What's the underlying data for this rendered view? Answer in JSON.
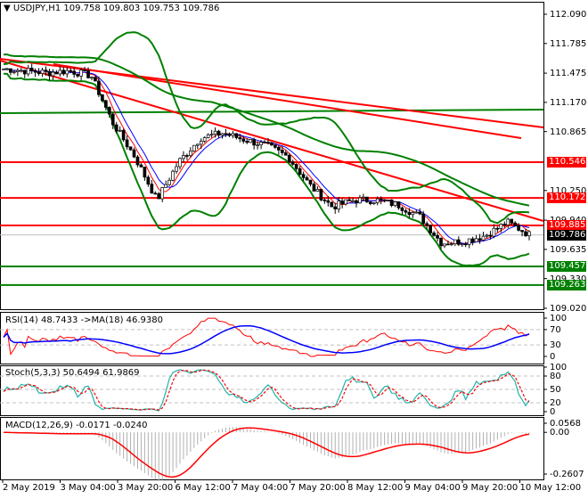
{
  "header": {
    "symbol": "USDJPY,H1",
    "open": "109.758",
    "high": "109.803",
    "low": "109.753",
    "close": "109.786"
  },
  "colors": {
    "bull": "#000000",
    "bear": "#000000",
    "support": "#008000",
    "resistance": "#ff0000",
    "bands": "#008000",
    "current": "#000000"
  },
  "chart_data": [
    {
      "type": "candlestick",
      "title": "USDJPY,H1",
      "ylim": [
        109.02,
        112.09
      ],
      "y_ticks": [
        "112.090",
        "111.785",
        "111.475",
        "111.170",
        "110.865",
        "110.546",
        "110.250",
        "110.172",
        "109.940",
        "109.885",
        "109.786",
        "109.635",
        "109.457",
        "109.330",
        "109.263",
        "109.020"
      ],
      "x_ticks": [
        "2 May 2019",
        "3 May 04:00",
        "3 May 20:00",
        "6 May 12:00",
        "7 May 04:00",
        "7 May 20:00",
        "8 May 12:00",
        "9 May 04:00",
        "9 May 20:00",
        "10 May 12:00"
      ],
      "approx_close_path": [
        111.52,
        111.5,
        111.48,
        111.5,
        111.45,
        110.95,
        110.6,
        110.15,
        110.55,
        110.8,
        110.85,
        110.78,
        110.72,
        110.6,
        110.3,
        110.08,
        110.15,
        110.15,
        110.1,
        109.98,
        109.7,
        109.72,
        109.78,
        109.92,
        109.79
      ],
      "levels": {
        "resistance": [
          "110.546",
          "110.172",
          "109.885"
        ],
        "support": [
          "109.457",
          "109.263"
        ],
        "current": "109.786"
      }
    },
    {
      "type": "line",
      "title": "RSI(14) 48.7433  ->MA(18) 46.9380",
      "ylim": [
        0,
        100
      ],
      "y_ticks": [
        "100",
        "70",
        "30",
        "0"
      ]
    },
    {
      "type": "line",
      "title": "Stoch(5,3,3) 50.6494 61.9869",
      "ylim": [
        0,
        100
      ],
      "y_ticks": [
        "100",
        "80",
        "50",
        "20",
        "0"
      ]
    },
    {
      "type": "bar",
      "title": "MACD(12,26,9) -0.0171 -0.0240",
      "ylim": [
        -0.2607,
        0.0568
      ],
      "y_ticks": [
        "0.0568",
        "0.00",
        "-0.2607"
      ]
    }
  ]
}
